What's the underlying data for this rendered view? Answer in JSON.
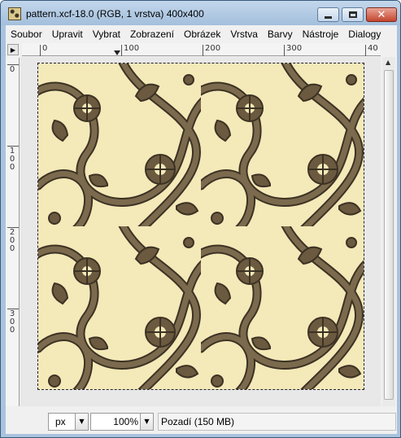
{
  "window": {
    "title": "pattern.xcf-18.0 (RGB, 1 vrstva) 400x400"
  },
  "menu": [
    {
      "label": "Soubor"
    },
    {
      "label": "Upravit"
    },
    {
      "label": "Vybrat"
    },
    {
      "label": "Zobrazení"
    },
    {
      "label": "Obrázek"
    },
    {
      "label": "Vrstva"
    },
    {
      "label": "Barvy"
    },
    {
      "label": "Nástroje"
    },
    {
      "label": "Dialogy"
    }
  ],
  "rulers": {
    "horizontal": [
      "0",
      "100",
      "200",
      "300",
      "40"
    ],
    "vertical": [
      "0",
      "1\n0\n0",
      "2\n0\n0",
      "3\n0\n0"
    ]
  },
  "canvas": {
    "pattern_color_bg": "#f4e9b8",
    "pattern_color_fg": "#6b5a3f",
    "pattern_color_outline": "#3c3224"
  },
  "status": {
    "unit": "px",
    "zoom": "100%",
    "layer_info": "Pozadí (150 MB)"
  }
}
